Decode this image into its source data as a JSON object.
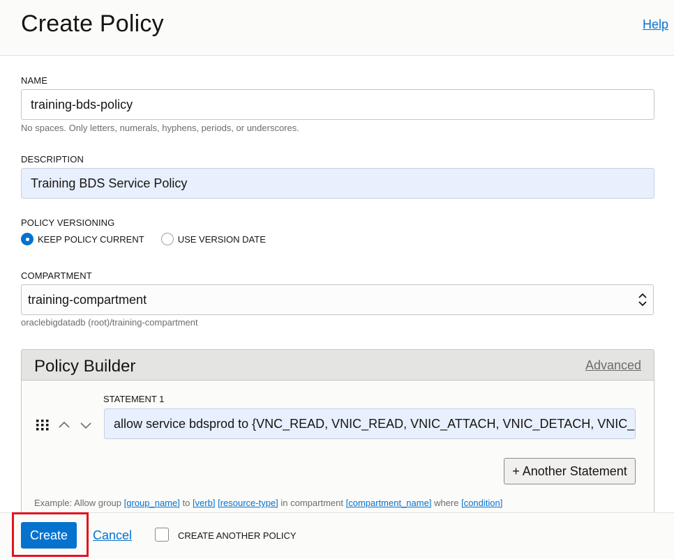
{
  "header": {
    "title": "Create Policy",
    "help_label": "Help"
  },
  "form": {
    "name": {
      "label": "NAME",
      "value": "training-bds-policy",
      "hint": "No spaces. Only letters, numerals, hyphens, periods, or underscores."
    },
    "description": {
      "label": "DESCRIPTION",
      "value": "Training BDS Service Policy"
    },
    "versioning": {
      "label": "POLICY VERSIONING",
      "options": [
        {
          "label": "KEEP POLICY CURRENT",
          "selected": true
        },
        {
          "label": "USE VERSION DATE",
          "selected": false
        }
      ]
    },
    "compartment": {
      "label": "COMPARTMENT",
      "value": "training-compartment",
      "path": "oraclebigdatadb (root)/training-compartment"
    }
  },
  "policy_builder": {
    "title": "Policy Builder",
    "advanced_label": "Advanced",
    "statement_label": "STATEMENT 1",
    "statement_value": "allow service bdsprod to {VNC_READ, VNIC_READ, VNIC_ATTACH, VNIC_DETACH, VNIC_CREATE, VNIC_DELETE} in compartment training-compartment",
    "another_button": "+ Another Statement",
    "example": {
      "prefix": "Example: Allow group ",
      "group": "[group_name]",
      "to": " to ",
      "verb": "[verb]",
      "space": " ",
      "resource": "[resource-type]",
      "in": " in compartment ",
      "compartment": "[compartment_name]",
      "where": " where ",
      "condition": "[condition]"
    }
  },
  "footer": {
    "create_label": "Create",
    "cancel_label": "Cancel",
    "create_another_label": "CREATE ANOTHER POLICY"
  },
  "colors": {
    "accent": "#0572ce",
    "highlight": "#e0141e",
    "autofill": "#e8f0fe"
  }
}
